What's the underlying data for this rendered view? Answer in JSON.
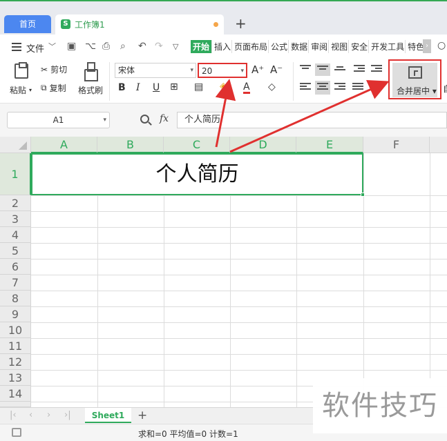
{
  "window": {
    "home_tab": "首页",
    "doc_tab": "工作簿1",
    "doc_icon": "S",
    "new_tab_symbol": "+"
  },
  "menu": {
    "file_label": "文件",
    "ribbon_tabs": [
      "开始",
      "插入",
      "页面布局",
      "公式",
      "数据",
      "审阅",
      "视图",
      "安全",
      "开发工具",
      "特色"
    ],
    "active_tab": "开始",
    "scroll_symbol": "›"
  },
  "ribbon": {
    "paste_label": "粘贴",
    "cut_label": "剪切",
    "copy_label": "复制",
    "format_painter_label": "格式刷",
    "font_name": "宋体",
    "font_size": "20",
    "grow_font": "A⁺",
    "shrink_font": "A⁻",
    "bold": "B",
    "italic": "I",
    "underline": "U",
    "font_color_letter": "A",
    "merge_label": "合并居中",
    "highlight_color": "#e0302f"
  },
  "formula_bar": {
    "cell_ref": "A1",
    "fx_label": "fx",
    "content": "个人简历"
  },
  "sheet": {
    "columns": [
      "A",
      "B",
      "C",
      "D",
      "E",
      "F"
    ],
    "rows": [
      "1",
      "2",
      "3",
      "4",
      "5",
      "6",
      "7",
      "8",
      "9",
      "10",
      "11",
      "12",
      "13",
      "14"
    ],
    "merged_cell_text": "个人简历",
    "accent_color": "#2faa5c"
  },
  "sheet_tabs": {
    "active": "Sheet1",
    "add_symbol": "+"
  },
  "status": {
    "text": "求和=0  平均值=0  计数=1"
  },
  "watermark": "软件技巧"
}
